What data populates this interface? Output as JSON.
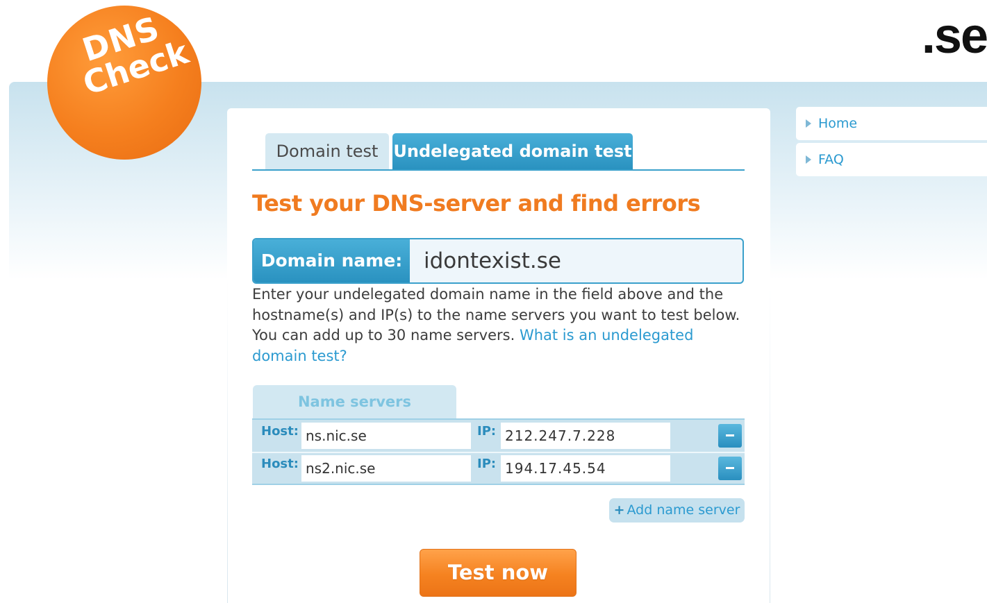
{
  "brand": {
    "logo_line1": "DNS",
    "logo_line2": "Check",
    "site_mark": ".se"
  },
  "tabs": [
    {
      "label": "Domain test",
      "active": false
    },
    {
      "label": "Undelegated domain test",
      "active": true
    }
  ],
  "headline": "Test your DNS-server and find errors",
  "domain": {
    "label": "Domain name:",
    "value": "idontexist.se"
  },
  "help": {
    "text": "Enter your undelegated domain name in the field above and the hostname(s) and IP(s) to the name servers you want to test below. You can add up to 30 name servers.",
    "link": "What is an undelegated domain test?"
  },
  "name_servers": {
    "heading": "Name servers",
    "host_label": "Host:",
    "ip_label": "IP:",
    "remove_symbol": "-",
    "rows": [
      {
        "host": "ns.nic.se",
        "ip": "212.247.7.228"
      },
      {
        "host": "ns2.nic.se",
        "ip": "194.17.45.54"
      }
    ],
    "add_symbol": "+",
    "add_label": "Add name server"
  },
  "submit_label": "Test now",
  "nav": [
    {
      "label": "Home"
    },
    {
      "label": "FAQ"
    }
  ],
  "colors": {
    "accent_orange": "#f07b20",
    "accent_blue": "#2a92c0",
    "link_blue": "#2b9ad0"
  }
}
